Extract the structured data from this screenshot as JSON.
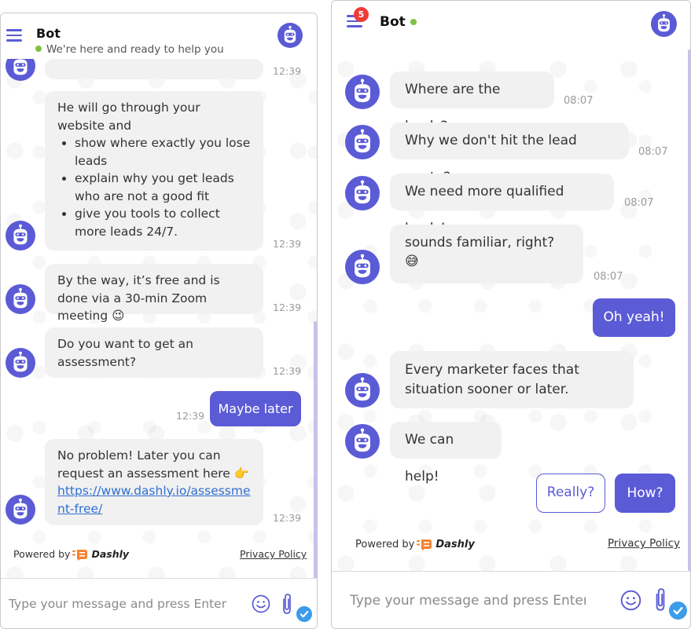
{
  "colors": {
    "accent": "#5b5bd6",
    "bubble_bg": "#f1f1f1",
    "status_online": "#7dc242",
    "badge_red": "#ef3b36",
    "check_blue": "#3d9be9",
    "link": "#2f6fd1",
    "brand_orange": "#f7822f"
  },
  "left_widget": {
    "header": {
      "title": "Bot",
      "subtitle": "We're here and ready to help you",
      "menu_icon": "hamburger-icon",
      "avatar_icon": "robot-avatar-icon"
    },
    "partial_message": {
      "time": "12:39"
    },
    "messages": [
      {
        "intro": "He will go through your website and",
        "bullets": [
          "show where exactly you lose leads",
          "explain why you get leads who are not a good fit",
          "give you tools to collect more leads 24/7."
        ],
        "time": "12:39"
      },
      {
        "text": "By the way, it’s free and is done via a 30-min Zoom meeting",
        "emoji": "😉",
        "time": "12:39"
      },
      {
        "text": "Do you want to get an assessment?",
        "time": "12:39"
      }
    ],
    "user_reply": {
      "text": "Maybe later",
      "time": "12:39"
    },
    "last_message": {
      "text": "No problem! Later you can request an assessment here",
      "emoji": "👉",
      "link": "https://www.dashly.io/assessment-free/",
      "time": "12:39"
    },
    "footer": {
      "powered_by": "Powered by",
      "brand": "Dashly",
      "privacy": "Privacy Policy"
    },
    "composer": {
      "placeholder": "Type your message and press Enter",
      "emoji_icon": "smiley-icon",
      "attach_icon": "paperclip-icon",
      "check_icon": "checkmark-icon"
    }
  },
  "right_widget": {
    "header": {
      "title": "Bot",
      "badge_count": "5",
      "menu_icon": "hamburger-icon",
      "avatar_icon": "robot-avatar-icon"
    },
    "messages": [
      {
        "text": "Where are the leads?",
        "time": "08:07"
      },
      {
        "text": "Why we don't hit the lead quota?",
        "time": "08:07"
      },
      {
        "text": "We need more qualified leads!",
        "time": "08:07"
      },
      {
        "text": "sounds familiar, right?",
        "emoji": "😅",
        "time": "08:07"
      }
    ],
    "user_reply": {
      "text": "Oh yeah!"
    },
    "messages_2": [
      {
        "text": "Every marketer faces that situation sooner or later."
      },
      {
        "text": "We can help!"
      }
    ],
    "quick_replies": [
      {
        "label": "Really?",
        "style": "outline"
      },
      {
        "label": "How?",
        "style": "filled"
      }
    ],
    "footer": {
      "powered_by": "Powered by",
      "brand": "Dashly",
      "privacy": "Privacy Policy"
    },
    "composer": {
      "placeholder": "Type your message and press Enter",
      "emoji_icon": "smiley-icon",
      "attach_icon": "paperclip-icon",
      "check_icon": "checkmark-icon"
    }
  }
}
